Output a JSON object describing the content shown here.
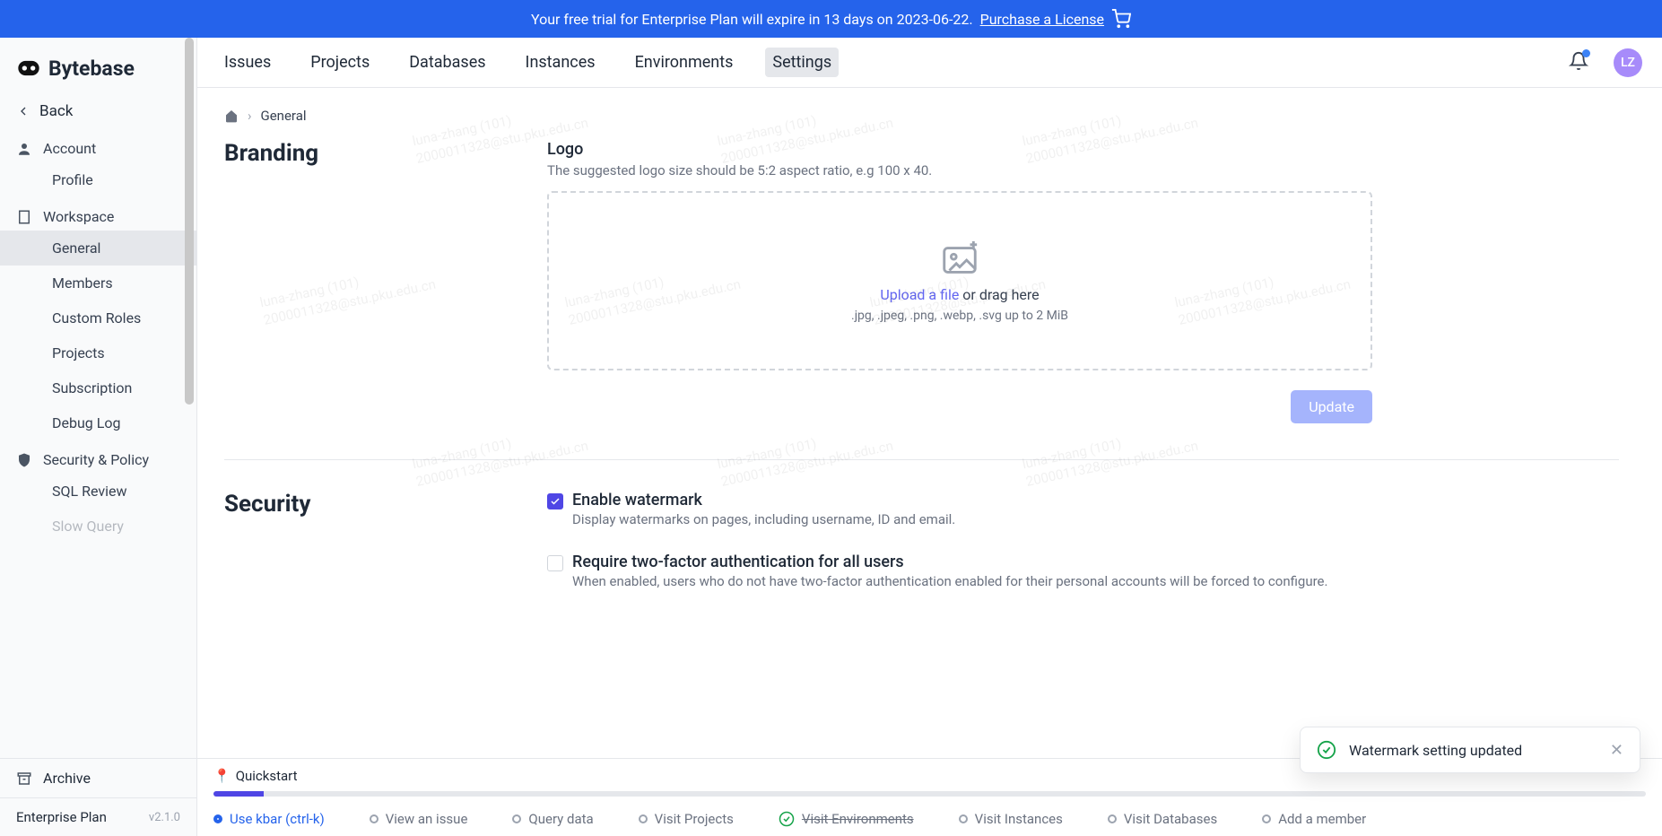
{
  "trial": {
    "text": "Your free trial for Enterprise Plan will expire in 13 days on 2023-06-22.",
    "cta": "Purchase a License"
  },
  "brand": {
    "name": "Bytebase"
  },
  "sidebar": {
    "back": "Back",
    "sections": {
      "account": {
        "title": "Account",
        "items": [
          "Profile"
        ]
      },
      "workspace": {
        "title": "Workspace",
        "items": [
          "General",
          "Members",
          "Custom Roles",
          "Projects",
          "Subscription",
          "Debug Log"
        ]
      },
      "security": {
        "title": "Security & Policy",
        "items": [
          "SQL Review",
          "Slow Query"
        ]
      }
    },
    "archive": "Archive",
    "plan": "Enterprise Plan",
    "version": "v2.1.0"
  },
  "topnav": [
    "Issues",
    "Projects",
    "Databases",
    "Instances",
    "Environments",
    "Settings"
  ],
  "avatar": "LZ",
  "breadcrumb": {
    "current": "General"
  },
  "branding": {
    "heading": "Branding",
    "logo_label": "Logo",
    "logo_help": "The suggested logo size should be 5:2 aspect ratio, e.g 100 x 40.",
    "upload_link": "Upload a file",
    "upload_rest": " or drag here",
    "upload_formats": ".jpg, .jpeg, .png, .webp, .svg up to 2 MiB",
    "update_btn": "Update"
  },
  "security_section": {
    "heading": "Security",
    "watermark": {
      "label": "Enable watermark",
      "help": "Display watermarks on pages, including username, ID and email.",
      "checked": true
    },
    "twofa": {
      "label": "Require two-factor authentication for all users",
      "help": "When enabled, users who do not have two-factor authentication enabled for their personal accounts will be forced to configure.",
      "checked": false
    }
  },
  "quickstart": {
    "title": "Quickstart",
    "items": [
      {
        "label": "Use kbar (ctrl-k)",
        "state": "active"
      },
      {
        "label": "View an issue",
        "state": "todo"
      },
      {
        "label": "Query data",
        "state": "todo"
      },
      {
        "label": "Visit Projects",
        "state": "todo"
      },
      {
        "label": "Visit Environments",
        "state": "done"
      },
      {
        "label": "Visit Instances",
        "state": "todo"
      },
      {
        "label": "Visit Databases",
        "state": "todo"
      },
      {
        "label": "Add a member",
        "state": "todo"
      }
    ]
  },
  "toast": {
    "message": "Watermark setting updated"
  },
  "watermark_text": {
    "line1": "luna-zhang (101)",
    "line2": "2000011328@stu.pku.edu.cn"
  }
}
